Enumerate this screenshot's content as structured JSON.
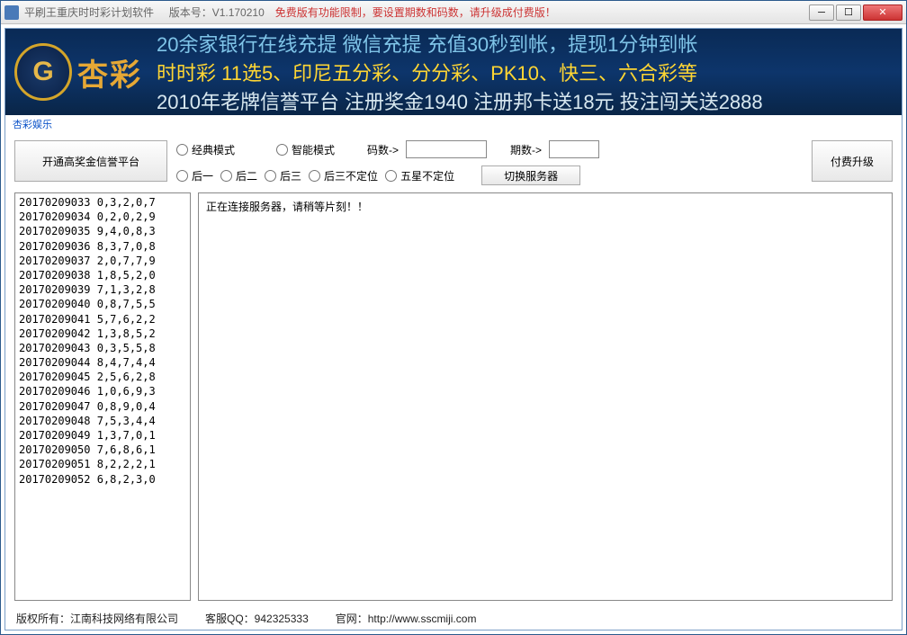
{
  "titlebar": {
    "app_name": "平刷王重庆时时彩计划软件",
    "version_label": "版本号：V1.170210",
    "warning": "免费版有功能限制，要设置期数和码数，请升级成付费版！"
  },
  "banner": {
    "logo_text": "杏彩",
    "line1": "20余家银行在线充提 微信充提   充值30秒到帐，提现1分钟到帐",
    "line2": "时时彩 11选5、印尼五分彩、分分彩、PK10、快三、六合彩等",
    "line3": "2010年老牌信誉平台 注册奖金1940     注册邦卡送18元 投注闯关送2888"
  },
  "small_link": "杏彩娱乐",
  "controls": {
    "open_platform_btn": "开通高奖金信誉平台",
    "upgrade_btn": "付费升级",
    "switch_server_btn": "切换服务器",
    "ma_label": "码数->",
    "qi_label": "期数->",
    "ma_value": "",
    "qi_value": "",
    "mode_radios": [
      "经典模式",
      "智能模式"
    ],
    "pos_radios": [
      "后一",
      "后二",
      "后三",
      "后三不定位",
      "五星不定位"
    ]
  },
  "history": [
    "20170209033 0,3,2,0,7",
    "20170209034 0,2,0,2,9",
    "20170209035 9,4,0,8,3",
    "20170209036 8,3,7,0,8",
    "20170209037 2,0,7,7,9",
    "20170209038 1,8,5,2,0",
    "20170209039 7,1,3,2,8",
    "20170209040 0,8,7,5,5",
    "20170209041 5,7,6,2,2",
    "20170209042 1,3,8,5,2",
    "20170209043 0,3,5,5,8",
    "20170209044 8,4,7,4,4",
    "20170209045 2,5,6,2,8",
    "20170209046 1,0,6,9,3",
    "20170209047 0,8,9,0,4",
    "20170209048 7,5,3,4,4",
    "20170209049 1,3,7,0,1",
    "20170209050 7,6,8,6,1",
    "20170209051 8,2,2,2,1",
    "20170209052 6,8,2,3,0"
  ],
  "log_message": "正在连接服务器，请稍等片刻！！",
  "footer": {
    "copyright": "版权所有：江南科技网络有限公司",
    "qq": "客服QQ：942325333",
    "site": "官网：http://www.sscmiji.com"
  }
}
